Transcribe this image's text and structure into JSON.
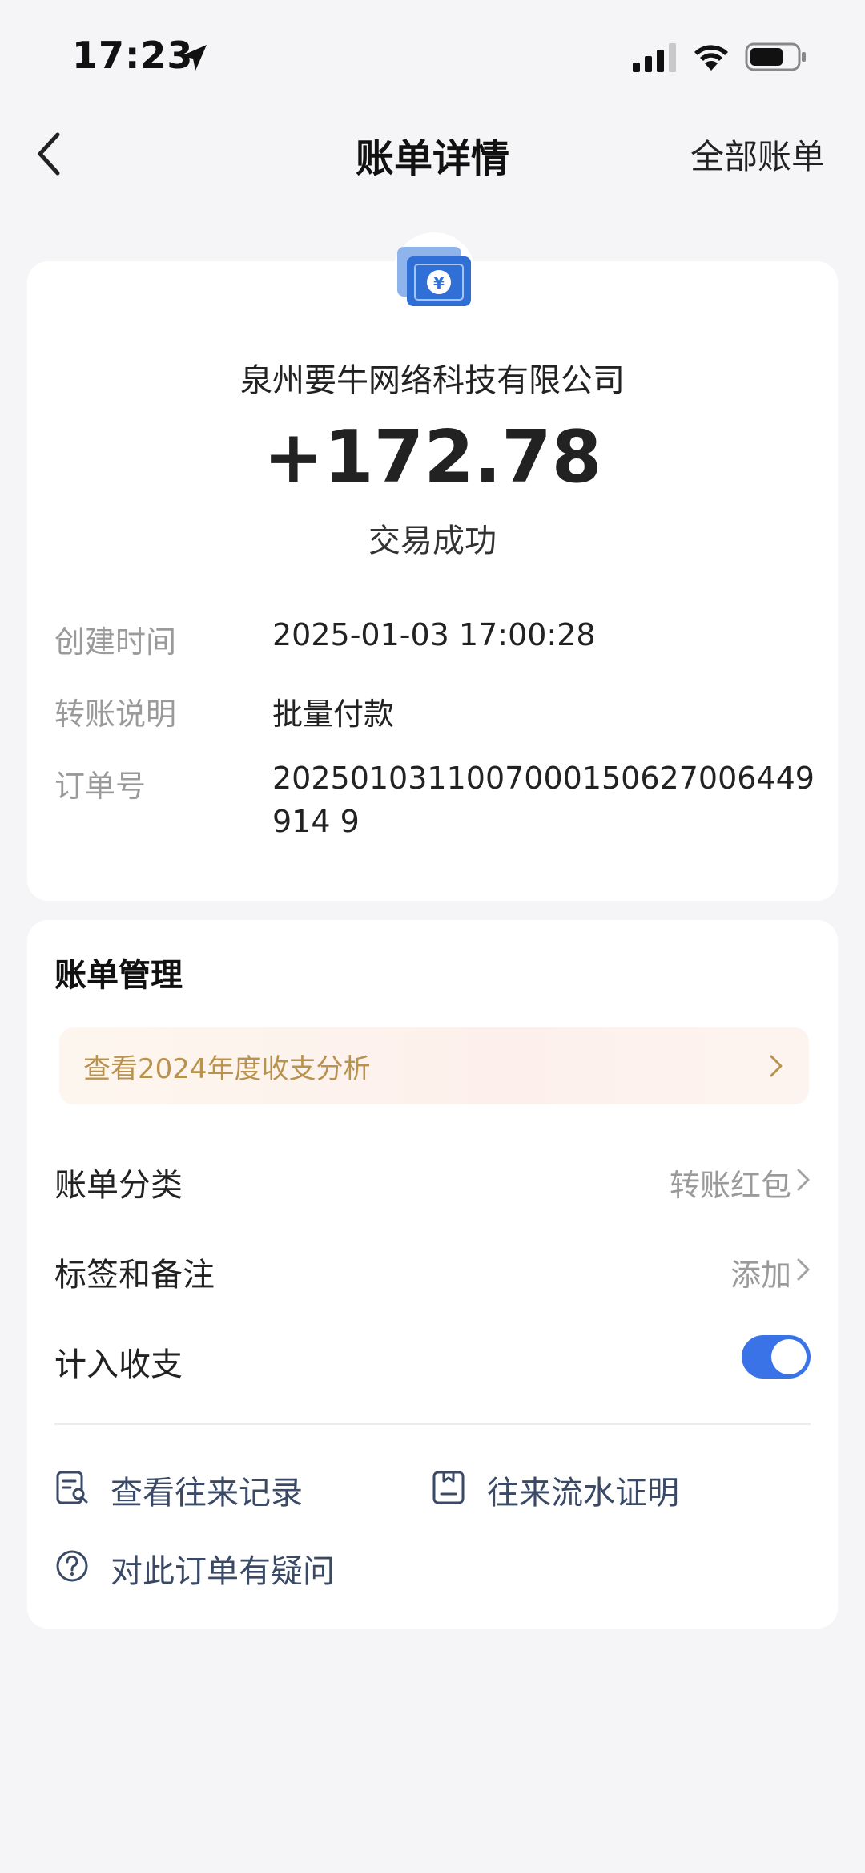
{
  "status_bar": {
    "time": "17:23"
  },
  "nav": {
    "title": "账单详情",
    "right_label": "全部账单"
  },
  "transaction": {
    "merchant": "泉州要牛网络科技有限公司",
    "amount": "+172.78",
    "status": "交易成功"
  },
  "details": [
    {
      "label": "创建时间",
      "value": "2025-01-03 17:00:28"
    },
    {
      "label": "转账说明",
      "value": "批量付款"
    },
    {
      "label": "订单号",
      "value": "2025010311007000150627006449914 9"
    }
  ],
  "management": {
    "title": "账单管理",
    "promo": "查看2024年度收支分析",
    "category_label": "账单分类",
    "category_value": "转账红包",
    "tags_label": "标签和备注",
    "tags_value": "添加",
    "include_label": "计入收支",
    "include_on": true,
    "links": {
      "records": "查看往来记录",
      "proof": "往来流水证明",
      "question": "对此订单有疑问"
    }
  },
  "colors": {
    "accent": "#3a72e8",
    "promo_text": "#b9924e",
    "background": "#f5f5f7"
  }
}
